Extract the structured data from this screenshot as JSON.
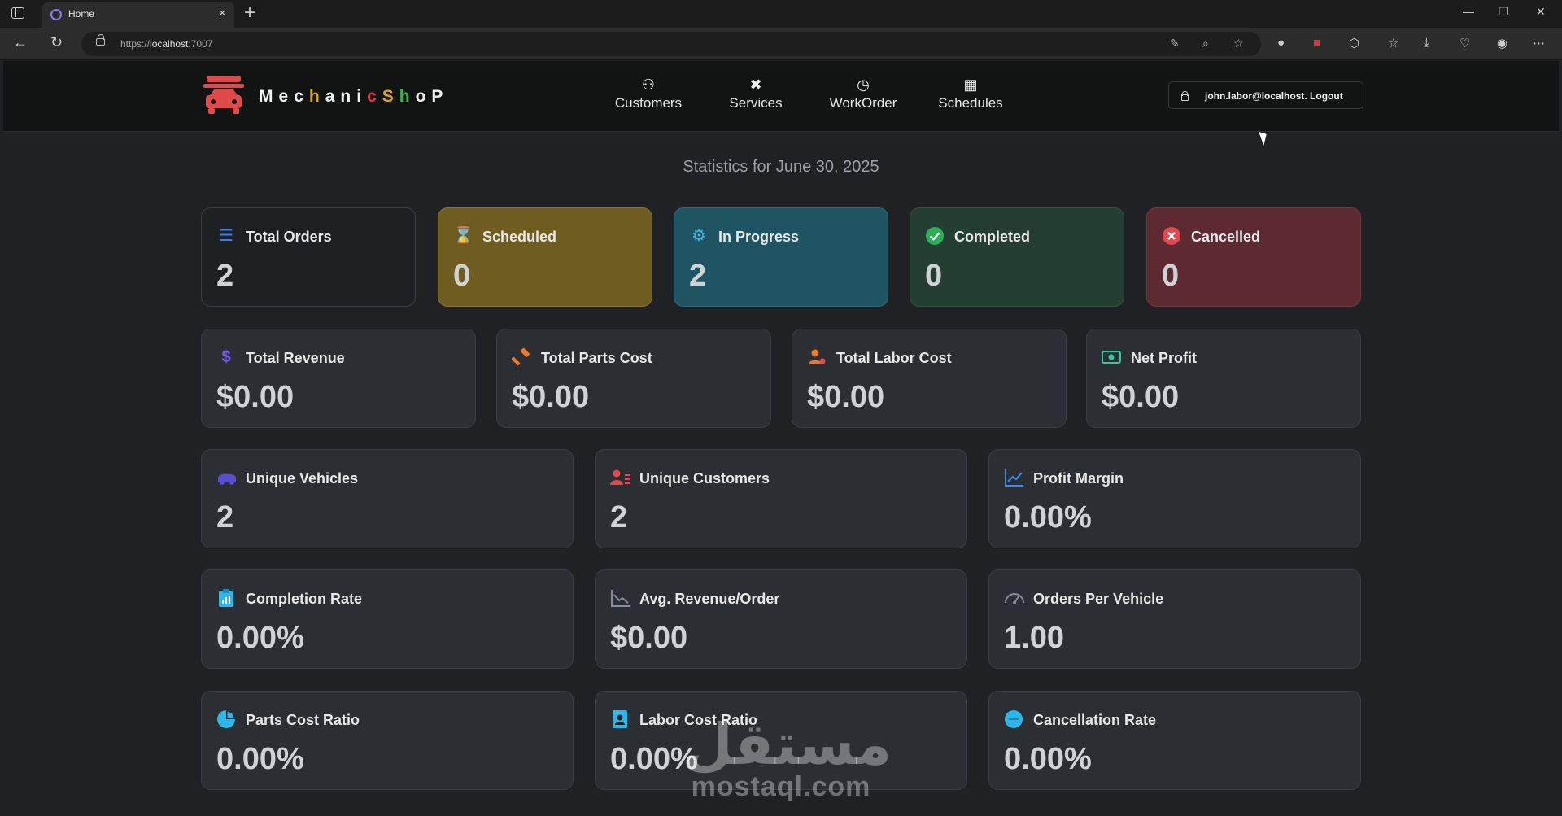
{
  "browser": {
    "tab_title": "Home",
    "url_prefix": "https://",
    "url_host": "localhost",
    "url_port": ":7007"
  },
  "app": {
    "brand_letters": [
      {
        "ch": "M",
        "color": "#f2f2f2"
      },
      {
        "ch": "e",
        "color": "#f2f2f2"
      },
      {
        "ch": "c",
        "color": "#f2f2f2"
      },
      {
        "ch": "h",
        "color": "#e0a21a"
      },
      {
        "ch": "a",
        "color": "#f2f2f2"
      },
      {
        "ch": "n",
        "color": "#f2f2f2"
      },
      {
        "ch": "i",
        "color": "#f2f2f2"
      },
      {
        "ch": "c",
        "color": "#e03a3a"
      },
      {
        "ch": "S",
        "color": "#e0a21a"
      },
      {
        "ch": "h",
        "color": "#3fb04f"
      },
      {
        "ch": "o",
        "color": "#f2f2f2"
      },
      {
        "ch": "P",
        "color": "#f2f2f2"
      }
    ],
    "nav": {
      "customers": "Customers",
      "services": "Services",
      "workorder": "WorkOrder",
      "schedules": "Schedules"
    },
    "user_label": "john.labor@localhost. Logout"
  },
  "stats": {
    "heading": "Statistics for June 30, 2025",
    "row1": [
      {
        "label": "Total Orders",
        "value": "2",
        "icon": "list-icon"
      },
      {
        "label": "Scheduled",
        "value": "0",
        "icon": "hourglass-icon"
      },
      {
        "label": "In Progress",
        "value": "2",
        "icon": "gear-icon"
      },
      {
        "label": "Completed",
        "value": "0",
        "icon": "check-circle-icon"
      },
      {
        "label": "Cancelled",
        "value": "0",
        "icon": "x-circle-icon"
      }
    ],
    "row2": [
      {
        "label": "Total Revenue",
        "value": "$0.00",
        "icon": "dollar-icon"
      },
      {
        "label": "Total Parts Cost",
        "value": "$0.00",
        "icon": "hammer-icon"
      },
      {
        "label": "Total Labor Cost",
        "value": "$0.00",
        "icon": "worker-icon"
      },
      {
        "label": "Net Profit",
        "value": "$0.00",
        "icon": "cash-icon"
      }
    ],
    "row3": [
      {
        "label": "Unique Vehicles",
        "value": "2",
        "icon": "car-icon"
      },
      {
        "label": "Unique Customers",
        "value": "2",
        "icon": "customers-icon"
      },
      {
        "label": "Profit Margin",
        "value": "0.00%",
        "icon": "trend-up-icon"
      }
    ],
    "row4": [
      {
        "label": "Completion Rate",
        "value": "0.00%",
        "icon": "clipboard-icon"
      },
      {
        "label": "Avg. Revenue/Order",
        "value": "$0.00",
        "icon": "chart-line-icon"
      },
      {
        "label": "Orders Per Vehicle",
        "value": "1.00",
        "icon": "speedometer-icon"
      }
    ],
    "row5": [
      {
        "label": "Parts Cost Ratio",
        "value": "0.00%",
        "icon": "pie-icon"
      },
      {
        "label": "Labor Cost Ratio",
        "value": "0.00%",
        "icon": "badge-icon"
      },
      {
        "label": "Cancellation Rate",
        "value": "0.00%",
        "icon": "circle-icon"
      }
    ]
  },
  "watermark": {
    "arabic": "مستقل",
    "latin": "mostaql.com"
  }
}
